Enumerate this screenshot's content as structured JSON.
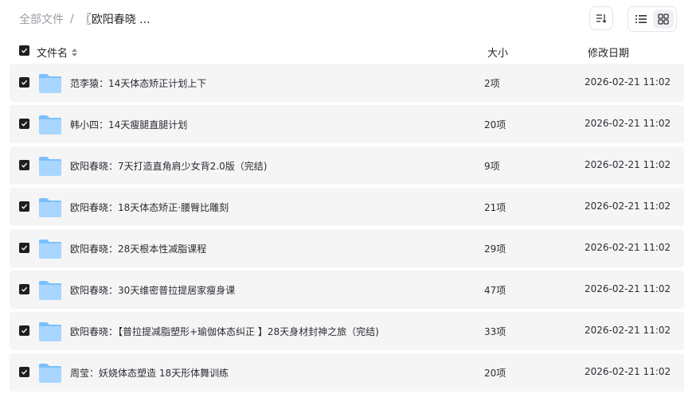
{
  "breadcrumb": {
    "root": "全部文件",
    "separator": "/",
    "current": "〖欧阳春晓 ..."
  },
  "toolbar": {
    "sort_icon": "sort-icon",
    "list_view_icon": "list-view-icon",
    "grid_view_icon": "grid-view-icon",
    "active_view": "list"
  },
  "header": {
    "name": "文件名",
    "size": "大小",
    "date": "修改日期",
    "all_checked": true
  },
  "files": [
    {
      "name": "范李猿：14天体态矫正计划上下",
      "size": "2项",
      "date": "2026-02-21 11:02",
      "checked": true
    },
    {
      "name": "韩小四：14天瘦腿直腿计划",
      "size": "20项",
      "date": "2026-02-21 11:02",
      "checked": true
    },
    {
      "name": "欧阳春晓：7天打造直角肩少女背2.0版（完结)",
      "size": "9项",
      "date": "2026-02-21 11:02",
      "checked": true
    },
    {
      "name": "欧阳春晓：18天体态矫正·腰臀比雕刻",
      "size": "21项",
      "date": "2026-02-21 11:02",
      "checked": true
    },
    {
      "name": "欧阳春晓：28天根本性减脂课程",
      "size": "29项",
      "date": "2026-02-21 11:02",
      "checked": true
    },
    {
      "name": "欧阳春晓：30天维密普拉提居家瘦身课",
      "size": "47项",
      "date": "2026-02-21 11:02",
      "checked": true
    },
    {
      "name": "欧阳春晓：【普拉提减脂塑形+瑜伽体态纠正 】28天身材封神之旅（完结)",
      "size": "33项",
      "date": "2026-02-21 11:02",
      "checked": true
    },
    {
      "name": "周莹：妖娆体态塑造 18天形体舞训练",
      "size": "20项",
      "date": "2026-02-21 11:02",
      "checked": true
    }
  ],
  "colors": {
    "row_bg": "#f5f5f6",
    "checkbox": "#1f1f1f",
    "folder_light": "#a8d6ff",
    "folder_dark": "#7cc0fb"
  }
}
